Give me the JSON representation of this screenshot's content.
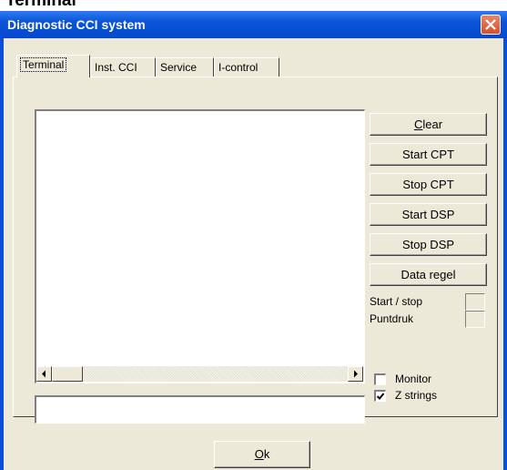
{
  "page_heading": "Terminal",
  "window": {
    "title": "Diagnostic CCI system"
  },
  "tabs": [
    {
      "label": "Terminal",
      "active": true
    },
    {
      "label": "Inst. CCI",
      "active": false
    },
    {
      "label": "Service",
      "active": false
    },
    {
      "label": "I-control",
      "active": false
    }
  ],
  "terminal": {
    "output_text": "",
    "input_value": ""
  },
  "buttons": {
    "clear_mnemonic": "C",
    "clear_rest": "lear",
    "start_cpt": "Start CPT",
    "stop_cpt": "Stop CPT",
    "start_dsp": "Start DSP",
    "stop_dsp": "Stop DSP",
    "data_regel": "Data regel"
  },
  "indicators": {
    "start_stop_label": "Start / stop",
    "puntdruk_label": "Puntdruk"
  },
  "checkboxes": [
    {
      "label": "Monitor",
      "checked": false
    },
    {
      "label": "Z strings",
      "checked": true
    }
  ],
  "ok": {
    "mnemonic": "O",
    "rest": "k"
  },
  "colors": {
    "title_bar": "#0a50d6",
    "dialog_face": "#ece9d8",
    "close_button": "#d4502e"
  }
}
